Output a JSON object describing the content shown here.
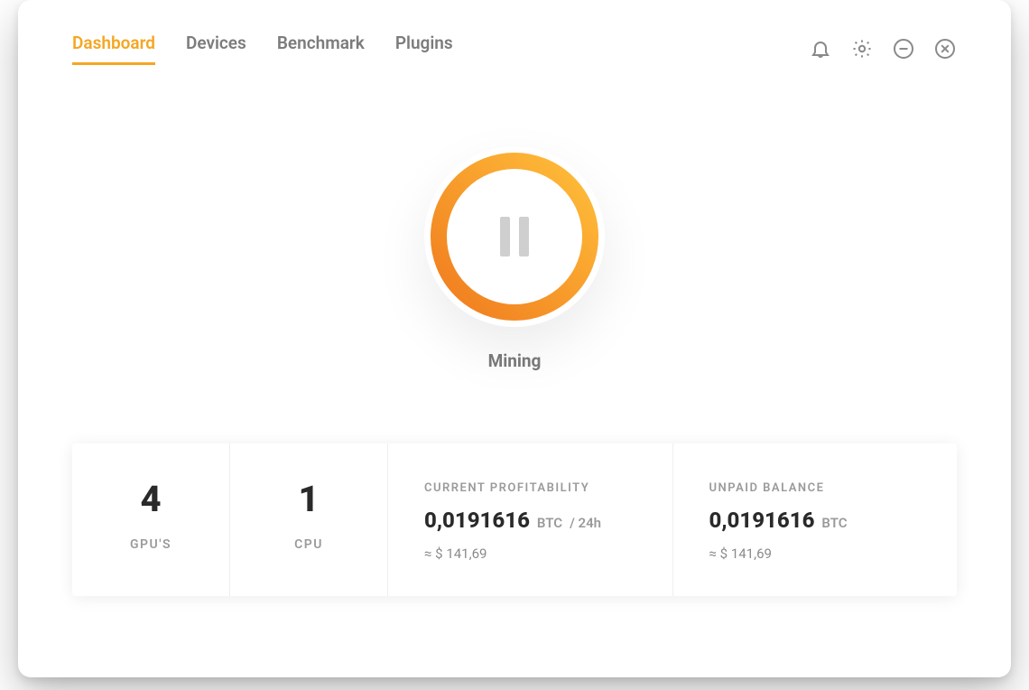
{
  "tabs": {
    "dashboard": "Dashboard",
    "devices": "Devices",
    "benchmark": "Benchmark",
    "plugins": "Plugins"
  },
  "status": {
    "label": "Mining"
  },
  "stats": {
    "gpu": {
      "count": "4",
      "label": "GPU'S"
    },
    "cpu": {
      "count": "1",
      "label": "CPU"
    },
    "profitability": {
      "title": "CURRENT PROFITABILITY",
      "value": "0,0191616",
      "unit": "BTC",
      "per": "/ 24h",
      "approx": "≈ $ 141,69"
    },
    "balance": {
      "title": "UNPAID BALANCE",
      "value": "0,0191616",
      "unit": "BTC",
      "approx": "≈ $ 141,69"
    }
  },
  "colors": {
    "accent_start": "#f07b1e",
    "accent_end": "#ffbf3a"
  }
}
